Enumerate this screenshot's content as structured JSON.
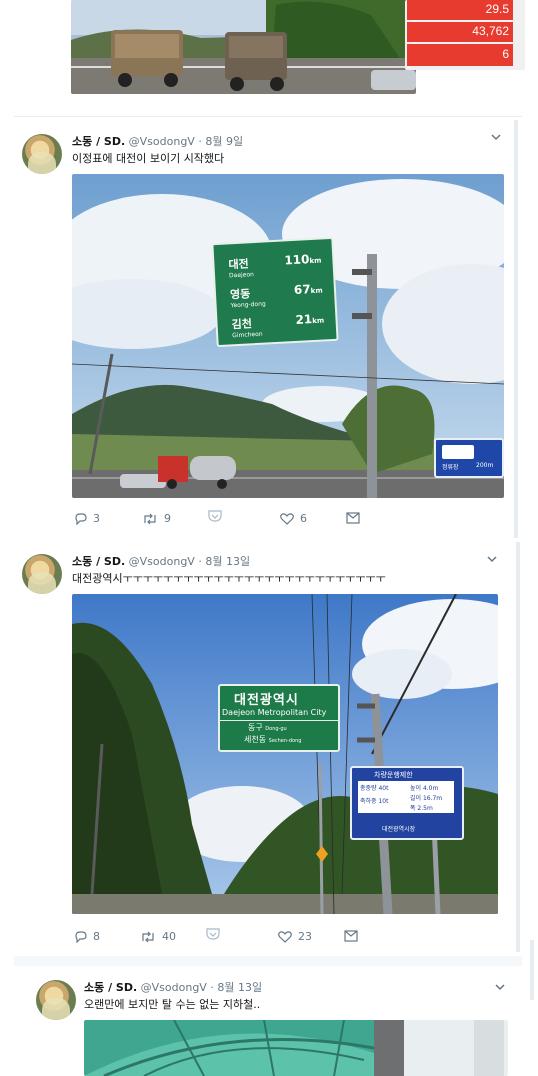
{
  "top_fragment": {
    "stats": [
      "29.5",
      "43,762",
      "6"
    ]
  },
  "tweets": [
    {
      "name": "소동 / SD.",
      "handle": "@VsodongV",
      "date": "· 8월 9일",
      "text": "이정표에 대전이 보이기 시작했다",
      "replies": "3",
      "retweets": "9",
      "likes": "6",
      "sign": {
        "rows": [
          {
            "ko": "대전",
            "en": "Daejeon",
            "dist": "110"
          },
          {
            "ko": "영동",
            "en": "Yeong-dong",
            "dist": "67"
          },
          {
            "ko": "김천",
            "en": "Gimcheon",
            "dist": "21"
          }
        ],
        "unit": "km"
      },
      "bus_sign": {
        "label": "정류장",
        "dist": "200m"
      }
    },
    {
      "name": "소동 / SD.",
      "handle": "@VsodongV",
      "date": "· 8월 13일",
      "text": "대전광역시ㅜㅜㅜㅜㅜㅜㅜㅜㅜㅜㅜㅜㅜㅜㅜㅜㅜㅜㅜㅜㅜㅜㅜㅜㅜㅜ",
      "replies": "8",
      "retweets": "40",
      "likes": "23",
      "sign": {
        "title": "대전광역시",
        "subtitle": "Daejeon Metropolitan City",
        "line1": "동구",
        "line1_en": "Dong-gu",
        "line2": "세천동",
        "line2_en": "Sechen-dong"
      },
      "blue_sign": {
        "title": "차량운행제한",
        "rows": [
          "총중량 40t",
          "높이 4.0m",
          "축하중 10t",
          "길이 16.7m",
          "폭 2.5m"
        ],
        "footer": "대전광역시장"
      }
    },
    {
      "name": "소동 / SD.",
      "handle": "@VsodongV",
      "date": "· 8월 13일",
      "text": "오랜만에 보지만 탈 수는 없는 지하철.."
    }
  ],
  "icons": {
    "reply": "reply-icon",
    "retweet": "retweet-icon",
    "like": "heart-icon",
    "dm": "dm-icon",
    "chevron": "chevron-down-icon"
  }
}
